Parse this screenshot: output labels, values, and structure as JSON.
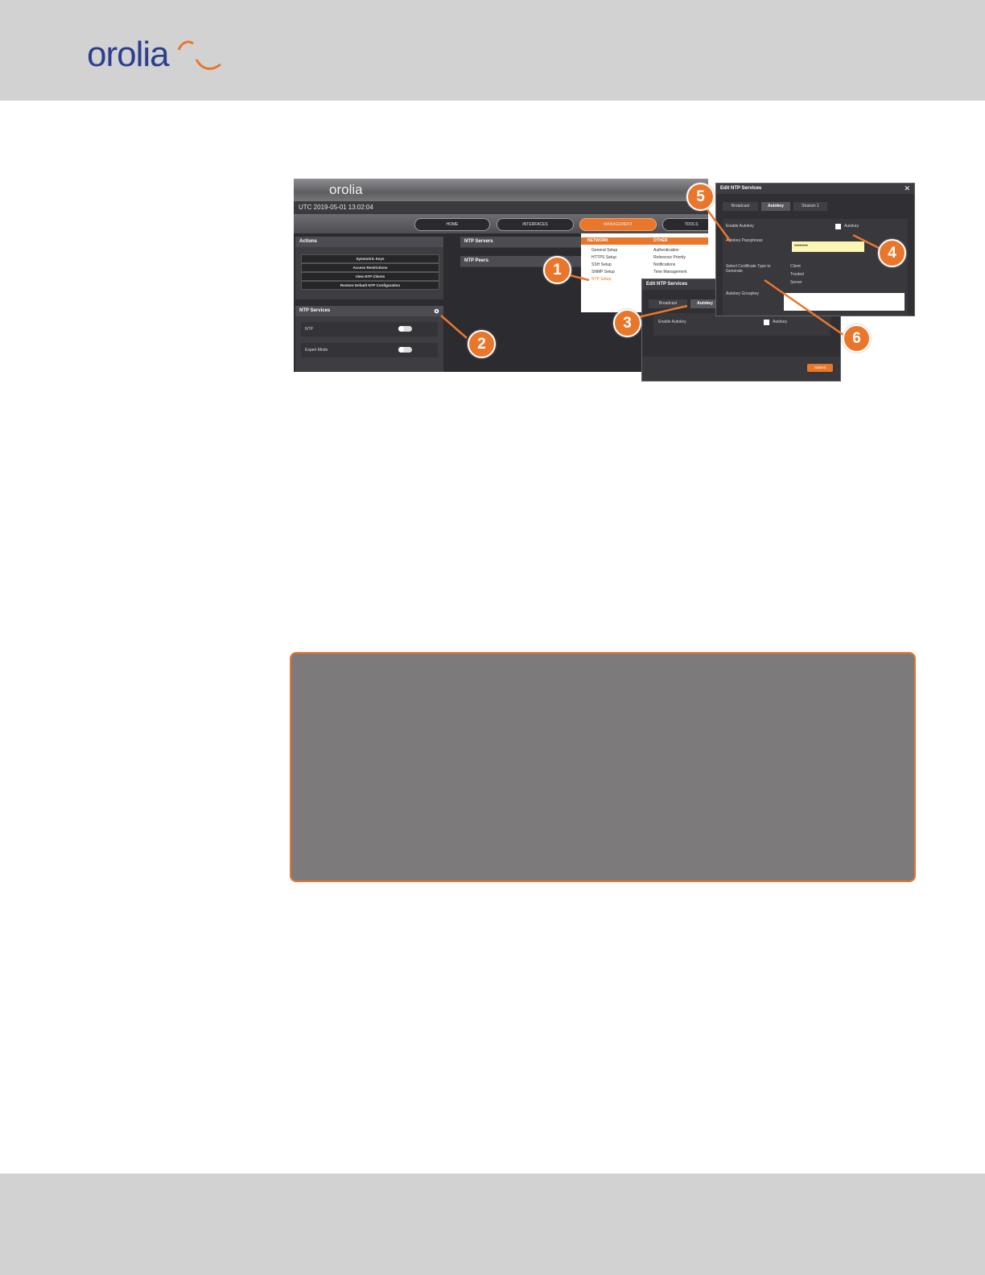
{
  "brand": {
    "logo_text": "orolia"
  },
  "screenshot": {
    "logo_text": "orolia",
    "utc": "UTC  2019-05-01 13:02:04",
    "nav": [
      "HOME",
      "INTERFACES",
      "MANAGEMENT",
      "TOOLS"
    ],
    "actions_title": "Actions",
    "actions": [
      "Symmetric Keys",
      "Access Restrictions",
      "View NTP Clients",
      "Restore Default NTP Configuration"
    ],
    "ntp_services_title": "NTP Services",
    "services": [
      "NTP",
      "Expert Mode"
    ],
    "ntp_servers": "NTP Servers",
    "ntp_peers": "NTP Peers",
    "menu": {
      "network_head": "NETWORK",
      "other_head": "OTHER",
      "network_items": [
        "General Setup",
        "HTTPS Setup",
        "SSH Setup",
        "SNMP Setup",
        "NTP Setup"
      ],
      "other_items": [
        "Authentication",
        "Reference Priority",
        "Notifications",
        "Time Management"
      ]
    },
    "dialog_small": {
      "title": "Edit NTP Services",
      "tabs": [
        "Broadcast",
        "Autokey"
      ],
      "field": "Enable Autokey",
      "checkbox_label": "Autokey",
      "submit": "Submit"
    },
    "dialog_large": {
      "title": "Edit NTP Services",
      "close": "✕",
      "tabs": [
        "Broadcast",
        "Autokey",
        "Stratum 1"
      ],
      "enable_label": "Enable Autokey",
      "checkbox_label": "Autokey",
      "passphrase_label": "Autokey Passphrase",
      "passphrase_value": "••••••••",
      "cert_label": "Select Certificate Type to Generate",
      "cert_options": [
        "Client",
        "Trusted",
        "Server"
      ],
      "group_label": "Autokey Groupkey"
    },
    "callouts": [
      "1",
      "2",
      "3",
      "4",
      "5",
      "6"
    ]
  },
  "colors": {
    "accent": "#e9772b",
    "header_bg": "#d2d2d2",
    "note_bg": "#7d7a7b",
    "brand_blue": "#2b3f8f"
  }
}
